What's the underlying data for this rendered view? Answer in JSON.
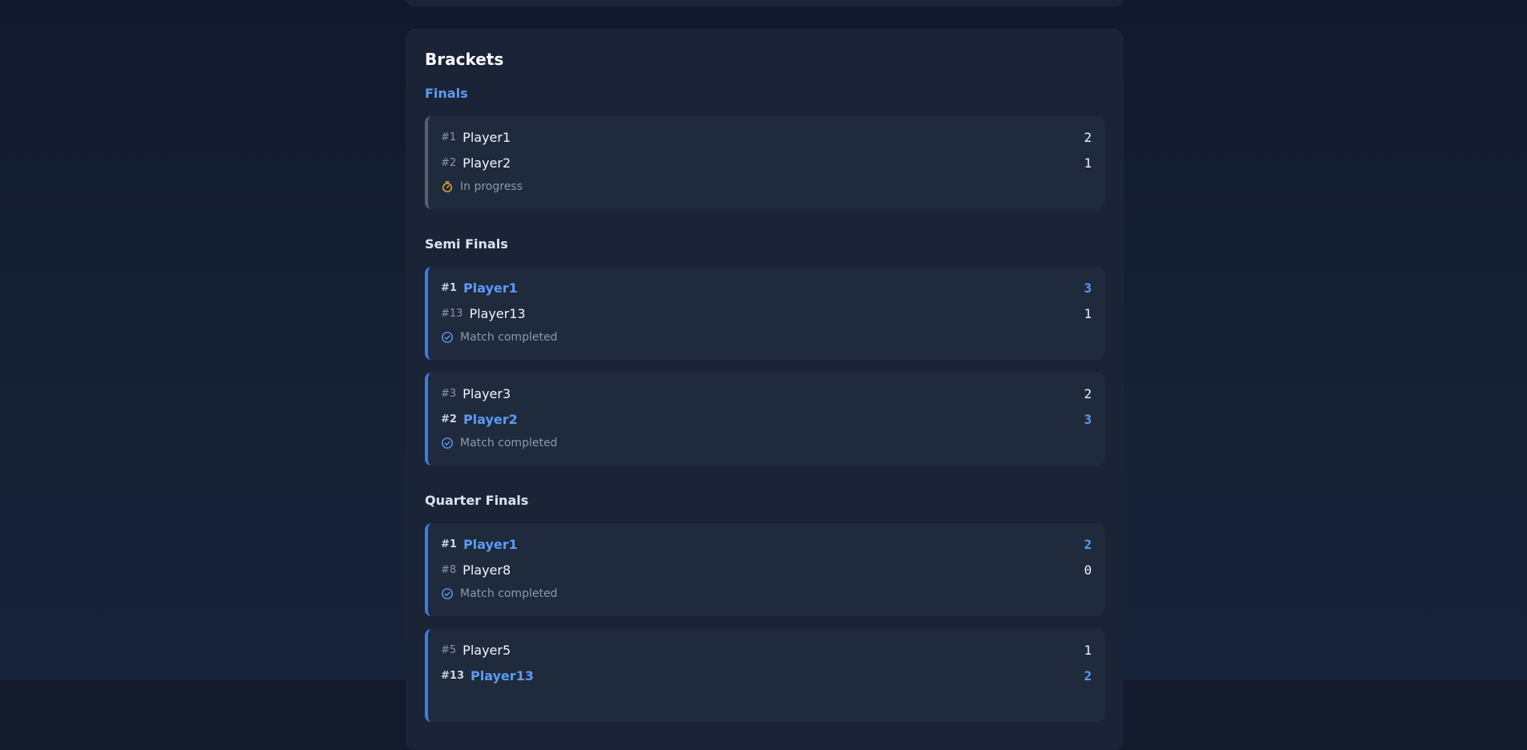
{
  "brackets": {
    "title": "Brackets",
    "rounds": [
      {
        "name": "Finals",
        "matches": [
          {
            "p1": {
              "seed": "#1",
              "name": "Player1",
              "score": "2",
              "winner": false
            },
            "p2": {
              "seed": "#2",
              "name": "Player2",
              "score": "1",
              "winner": false
            },
            "status": "In progress",
            "status_icon": "stopwatch-icon"
          }
        ]
      },
      {
        "name": "Semi Finals",
        "matches": [
          {
            "p1": {
              "seed": "#1",
              "name": "Player1",
              "score": "3",
              "winner": true
            },
            "p2": {
              "seed": "#13",
              "name": "Player13",
              "score": "1",
              "winner": false
            },
            "status": "Match completed",
            "status_icon": "check-circle-icon"
          },
          {
            "p1": {
              "seed": "#3",
              "name": "Player3",
              "score": "2",
              "winner": false
            },
            "p2": {
              "seed": "#2",
              "name": "Player2",
              "score": "3",
              "winner": true
            },
            "status": "Match completed",
            "status_icon": "check-circle-icon"
          }
        ]
      },
      {
        "name": "Quarter Finals",
        "matches": [
          {
            "p1": {
              "seed": "#1",
              "name": "Player1",
              "score": "2",
              "winner": true
            },
            "p2": {
              "seed": "#8",
              "name": "Player8",
              "score": "0",
              "winner": false
            },
            "status": "Match completed",
            "status_icon": "check-circle-icon"
          },
          {
            "p1": {
              "seed": "#5",
              "name": "Player5",
              "score": "1",
              "winner": false
            },
            "p2": {
              "seed": "#13",
              "name": "Player13",
              "score": "2",
              "winner": true
            },
            "status": "",
            "status_icon": ""
          }
        ]
      }
    ]
  },
  "colors": {
    "accent": "#5b9cf2",
    "in_progress": "#e7b32c",
    "background": "#121a2b",
    "panel": "#1a2436",
    "card": "#1f2a3d"
  }
}
